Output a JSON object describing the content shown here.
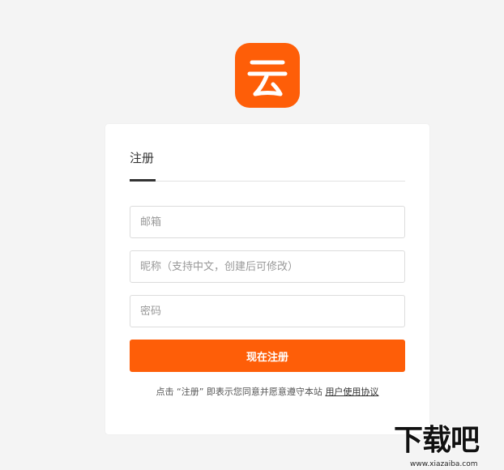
{
  "brand": {
    "logo_icon": "cloud-logo-icon",
    "accent_color": "#fe5e08"
  },
  "form": {
    "tab_label": "注册",
    "email_placeholder": "邮箱",
    "nickname_placeholder": "昵称（支持中文，创建后可修改）",
    "password_placeholder": "密码",
    "submit_label": "现在注册",
    "notice_prefix": "点击 “注册” 即表示您同意并愿意遵守本站 ",
    "agreement_link": "用户使用协议"
  },
  "watermark": {
    "title": "下载吧",
    "url": "www.xiazaiba.com"
  }
}
